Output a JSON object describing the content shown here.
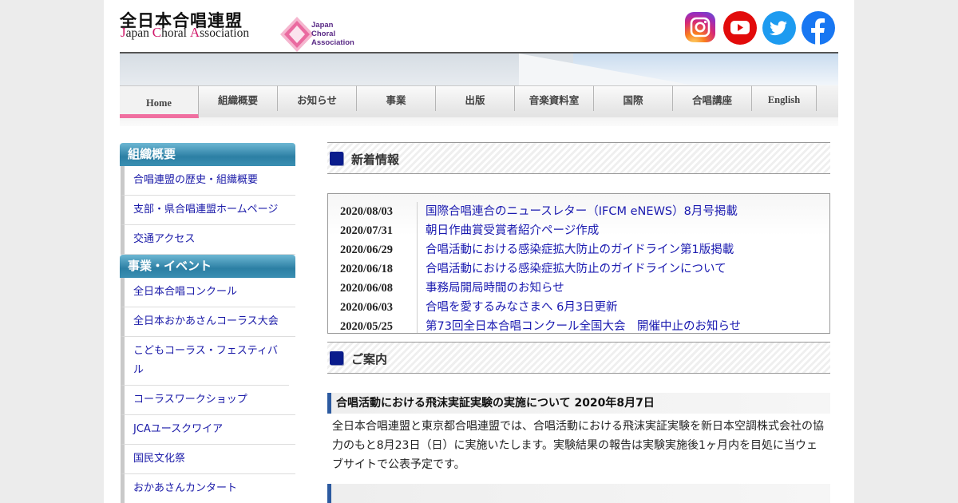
{
  "header": {
    "logo_jp": "全日本合唱連盟",
    "logo_en_parts": [
      "J",
      "apan ",
      "C",
      "horal ",
      "A",
      "ssociation"
    ],
    "mark_text": "Japan\nChoral\nAssociation"
  },
  "social": {
    "instagram": "instagram-icon",
    "youtube": "youtube-icon",
    "twitter": "twitter-icon",
    "facebook": "facebook-icon"
  },
  "nav": {
    "items": [
      "Home",
      "組織概要",
      "お知らせ",
      "事業",
      "出版",
      "音楽資料室",
      "国際",
      "合唱講座",
      "English"
    ],
    "active": "Home"
  },
  "sidebar": {
    "sections": [
      {
        "heading": "組織概要",
        "items": [
          "合唱連盟の歴史・組織概要",
          "支部・県合唱連盟ホームページ",
          "交通アクセス"
        ]
      },
      {
        "heading": "事業・イベント",
        "items": [
          "全日本合唱コンクール",
          "全日本おかあさんコーラス大会",
          "こどもコーラス・フェスティバル",
          "コーラスワークショップ",
          "JCAユースクワイア",
          "国民文化祭",
          "おかあさんカンタート"
        ]
      }
    ]
  },
  "news": {
    "heading": "新着情報",
    "rows": [
      {
        "date": "2020/08/03",
        "title": "国際合唱連合のニュースレター（IFCM eNEWS）8月号掲載"
      },
      {
        "date": "2020/07/31",
        "title": "朝日作曲賞受賞者紹介ページ作成"
      },
      {
        "date": "2020/06/29",
        "title": "合唱活動における感染症拡大防止のガイドライン第1版掲載"
      },
      {
        "date": "2020/06/18",
        "title": "合唱活動における感染症拡大防止のガイドラインについて"
      },
      {
        "date": "2020/06/08",
        "title": "事務局開局時間のお知らせ"
      },
      {
        "date": "2020/06/03",
        "title": "合唱を愛するみなさまへ 6月3日更新"
      },
      {
        "date": "2020/05/25",
        "title": "第73回全日本合唱コンクール全国大会　開催中止のお知らせ"
      }
    ]
  },
  "guide": {
    "heading": "ご案内",
    "article_title": "合唱活動における飛沫実証実験の実施について 2020年8月7日",
    "article_body": "全日本合唱連盟と東京都合唱連盟では、合唱活動における飛沫実証実験を新日本空調株式会社の協力のもと8月23日（日）に実施いたします。実験結果の報告は実験実施後1ヶ月内を目処に当ウェブサイトで公表予定です。"
  },
  "colors": {
    "nav_active": "#f06fa0",
    "sidebar_head": "#2c7fa4",
    "link": "#1a1ab0",
    "section_square": "#0a1c8c"
  }
}
